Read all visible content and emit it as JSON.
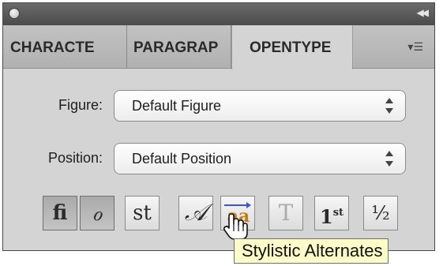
{
  "tabs": [
    {
      "label": "CHARACTE"
    },
    {
      "label": "PARAGRAP"
    },
    {
      "label": "OPENTYPE"
    }
  ],
  "active_tab": "OPENTYPE",
  "titlebar": {
    "close_icon": "circle",
    "collapse_icon": "double-chevron-right"
  },
  "panel_menu_icon": "panel-menu-icon",
  "figure": {
    "label": "Figure:",
    "value": "Default Figure"
  },
  "position": {
    "label": "Position:",
    "value": "Default Position"
  },
  "glyph_buttons": [
    {
      "name": "ligatures",
      "glyph": "fi",
      "active": true
    },
    {
      "name": "contextual-alternates",
      "glyph": "ℴ",
      "active": true
    },
    {
      "name": "discretionary-ligatures",
      "glyph": "st",
      "active": false
    },
    {
      "name": "swash",
      "glyph": "𝒜",
      "active": false
    },
    {
      "name": "stylistic-alternates",
      "glyph": "aa",
      "active": false,
      "hovered": true
    },
    {
      "name": "titling-alternates",
      "glyph": "T",
      "active": false,
      "disabled": true
    },
    {
      "name": "ordinal",
      "glyph": "1",
      "sup": "st",
      "active": false
    },
    {
      "name": "fractions",
      "glyph": "½",
      "active": false
    }
  ],
  "tooltip": "Stylistic Alternates",
  "colors": {
    "panel": "#d4d4d4",
    "titlebar": "#5a5a5a",
    "tooltip_bg": "#fdfbc8",
    "stylistic_accent": "#c77a16",
    "arrow": "#3a55d8"
  }
}
